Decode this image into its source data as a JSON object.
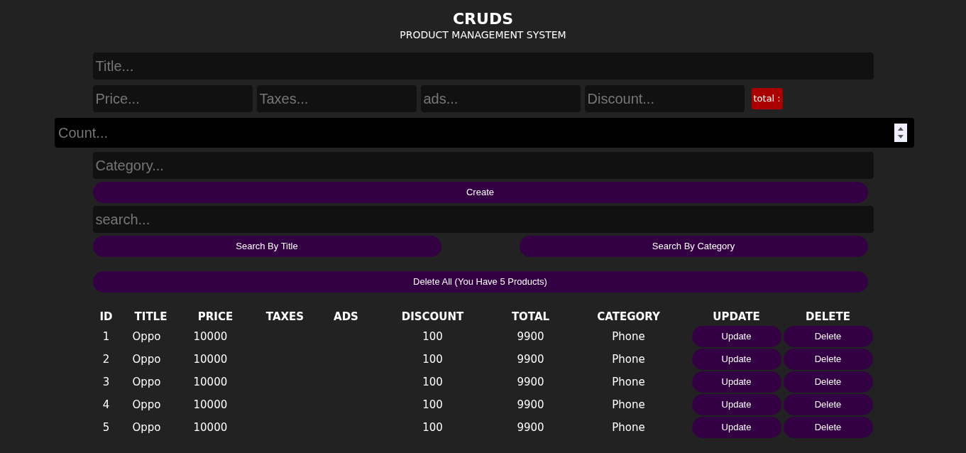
{
  "header": {
    "title": "CRUDS",
    "subtitle": "PRODUCT MANAGEMENT SYSTEM"
  },
  "form": {
    "title": {
      "placeholder": "Title..."
    },
    "price_fields": [
      {
        "placeholder": "Price..."
      },
      {
        "placeholder": "Taxes..."
      },
      {
        "placeholder": "ads..."
      },
      {
        "placeholder": "Discount..."
      }
    ],
    "total_label": "total :",
    "count": {
      "placeholder": "Count..."
    },
    "category": {
      "placeholder": "Category..."
    },
    "create_button": "Create"
  },
  "search": {
    "placeholder": "search...",
    "buttons": [
      "Search By Title",
      "Search By Category"
    ]
  },
  "delete_all_button": "Delete All (You Have 5 Products)",
  "table": {
    "columns": [
      "ID",
      "TITLE",
      "PRICE",
      "TAXES",
      "ADS",
      "DISCOUNT",
      "TOTAL",
      "CATEGORY",
      "UPDATE",
      "DELETE"
    ],
    "rows": [
      {
        "id": "1",
        "title": "Oppo",
        "price": "10000",
        "taxes": "",
        "ads": "",
        "discount": "100",
        "total": "9900",
        "category": "Phone",
        "update": "Update",
        "delete": "Delete"
      },
      {
        "id": "2",
        "title": "Oppo",
        "price": "10000",
        "taxes": "",
        "ads": "",
        "discount": "100",
        "total": "9900",
        "category": "Phone",
        "update": "Update",
        "delete": "Delete"
      },
      {
        "id": "3",
        "title": "Oppo",
        "price": "10000",
        "taxes": "",
        "ads": "",
        "discount": "100",
        "total": "9900",
        "category": "Phone",
        "update": "Update",
        "delete": "Delete"
      },
      {
        "id": "4",
        "title": "Oppo",
        "price": "10000",
        "taxes": "",
        "ads": "",
        "discount": "100",
        "total": "9900",
        "category": "Phone",
        "update": "Update",
        "delete": "Delete"
      },
      {
        "id": "5",
        "title": "Oppo",
        "price": "10000",
        "taxes": "",
        "ads": "",
        "discount": "100",
        "total": "9900",
        "category": "Phone",
        "update": "Update",
        "delete": "Delete"
      }
    ]
  }
}
